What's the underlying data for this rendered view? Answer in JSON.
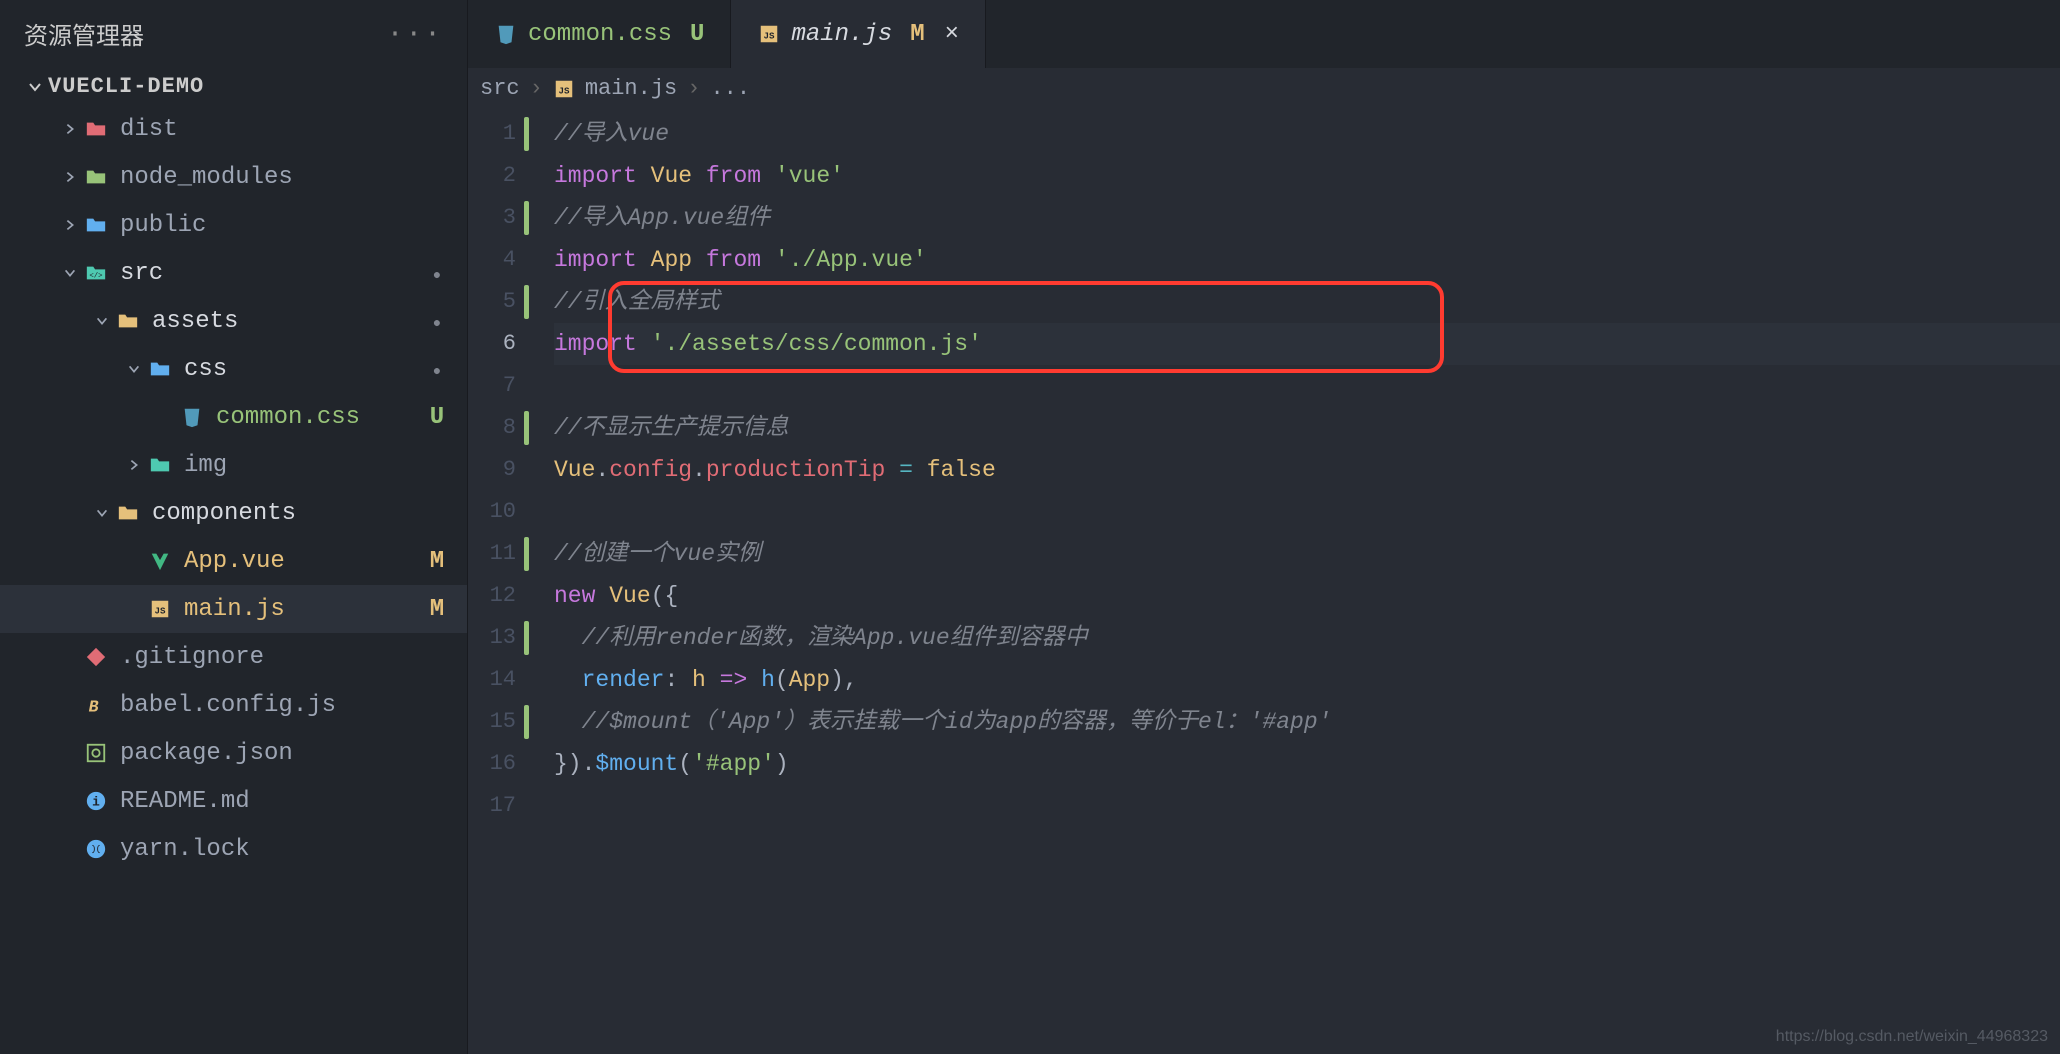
{
  "sidebar": {
    "title": "资源管理器",
    "section_title": "VUECLI-DEMO",
    "items": [
      {
        "label": "dist",
        "depth": 1,
        "chev": "right",
        "icon": "folder-red",
        "status": ""
      },
      {
        "label": "node_modules",
        "depth": 1,
        "chev": "right",
        "icon": "folder-green",
        "status": ""
      },
      {
        "label": "public",
        "depth": 1,
        "chev": "right",
        "icon": "folder-blue",
        "status": ""
      },
      {
        "label": "src",
        "depth": 1,
        "chev": "down",
        "icon": "folder-src",
        "status": "dot",
        "bright": true
      },
      {
        "label": "assets",
        "depth": 2,
        "chev": "down",
        "icon": "folder-assets",
        "status": "dot",
        "bright": true
      },
      {
        "label": "css",
        "depth": 3,
        "chev": "down",
        "icon": "folder-css",
        "status": "dot",
        "bright": true
      },
      {
        "label": "common.css",
        "depth": 4,
        "chev": "",
        "icon": "css-file",
        "status": "U",
        "bright": false,
        "greenlabel": true
      },
      {
        "label": "img",
        "depth": 3,
        "chev": "right",
        "icon": "folder-img",
        "status": ""
      },
      {
        "label": "components",
        "depth": 2,
        "chev": "down",
        "icon": "folder-components",
        "status": "",
        "bright": true
      },
      {
        "label": "App.vue",
        "depth": 3,
        "chev": "",
        "icon": "vue-file",
        "status": "M",
        "yellowlabel": true
      },
      {
        "label": "main.js",
        "depth": 3,
        "chev": "",
        "icon": "js-file",
        "status": "M",
        "yellowlabel": true,
        "active": true
      },
      {
        "label": ".gitignore",
        "depth": 1,
        "chev": "",
        "icon": "git-file",
        "status": ""
      },
      {
        "label": "babel.config.js",
        "depth": 1,
        "chev": "",
        "icon": "babel-file",
        "status": ""
      },
      {
        "label": "package.json",
        "depth": 1,
        "chev": "",
        "icon": "npm-file",
        "status": ""
      },
      {
        "label": "README.md",
        "depth": 1,
        "chev": "",
        "icon": "info-file",
        "status": ""
      },
      {
        "label": "yarn.lock",
        "depth": 1,
        "chev": "",
        "icon": "yarn-file",
        "status": ""
      }
    ]
  },
  "tabs": [
    {
      "icon": "css-file",
      "label": "common.css",
      "status": "U",
      "status_class": "U",
      "active": false
    },
    {
      "icon": "js-file",
      "label": "main.js",
      "status": "M",
      "status_class": "M",
      "active": true,
      "italic": true
    }
  ],
  "breadcrumb": {
    "seg1": "src",
    "file_icon": "js-file",
    "file": "main.js",
    "tail": "..."
  },
  "code": {
    "lines": 17,
    "active_line": 6,
    "modified_lines": [
      1,
      3,
      5,
      8,
      11,
      13,
      15
    ],
    "content": {
      "l1_comment": "//导入vue",
      "l2_import": "import",
      "l2_Vue": "Vue",
      "l2_from": "from",
      "l2_str": "'vue'",
      "l3_comment": "//导入App.vue组件",
      "l4_import": "import",
      "l4_App": "App",
      "l4_from": "from",
      "l4_str": "'./App.vue'",
      "l5_comment": "//引入全局样式",
      "l6_import": "import",
      "l6_str": "'./assets/css/common.js'",
      "l8_comment": "//不显示生产提示信息",
      "l9_Vue": "Vue",
      "l9_dot1": ".",
      "l9_config": "config",
      "l9_dot2": ".",
      "l9_tip": "productionTip",
      "l9_eq": " = ",
      "l9_false": "false",
      "l11_comment": "//创建一个vue实例",
      "l12_new": "new",
      "l12_Vue": "Vue",
      "l12_open": "({",
      "l13_comment": "//利用render函数，渲染App.vue组件到容器中",
      "l14_render": "render",
      "l14_colon": ": ",
      "l14_h1": "h",
      "l14_arrow": " => ",
      "l14_h2": "h",
      "l14_paro": "(",
      "l14_App": "App",
      "l14_parc": "),",
      "l15_comment": "//$mount（'App'）表示挂载一个id为app的容器，等价于el：'#app'",
      "l16_close": "}).",
      "l16_mount": "$mount",
      "l16_po": "(",
      "l16_str": "'#app'",
      "l16_pc": ")"
    }
  },
  "watermark": "https://blog.csdn.net/weixin_44968323"
}
